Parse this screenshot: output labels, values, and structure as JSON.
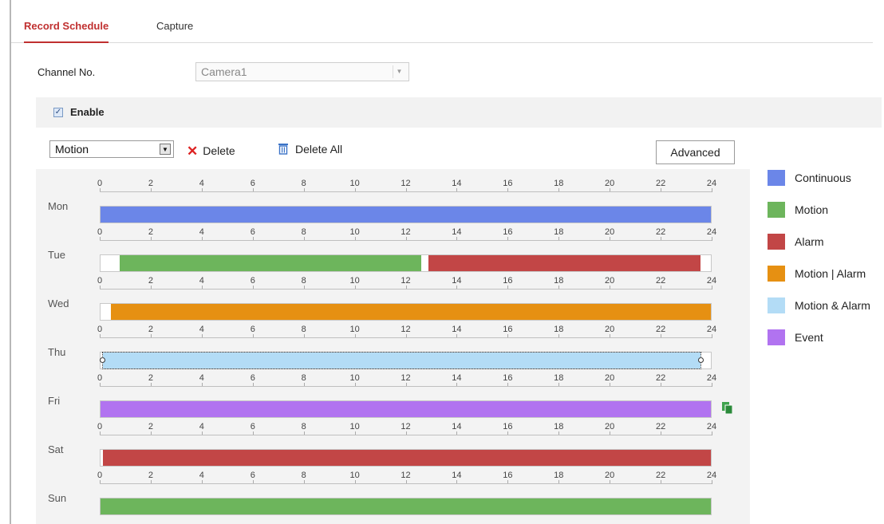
{
  "tabs": [
    {
      "label": "Record Schedule",
      "active": true
    },
    {
      "label": "Capture",
      "active": false
    }
  ],
  "channel": {
    "label": "Channel No.",
    "value": "Camera1"
  },
  "enable": {
    "label": "Enable",
    "checked": true
  },
  "toolbar": {
    "record_type": "Motion",
    "delete_label": "Delete",
    "delete_all_label": "Delete All",
    "advanced_label": "Advanced"
  },
  "hour_ticks": [
    "0",
    "2",
    "4",
    "6",
    "8",
    "10",
    "12",
    "14",
    "16",
    "18",
    "20",
    "22",
    "24"
  ],
  "legend": [
    {
      "label": "Continuous",
      "color": "#6b86e8"
    },
    {
      "label": "Motion",
      "color": "#6db55c"
    },
    {
      "label": "Alarm",
      "color": "#c24646"
    },
    {
      "label": "Motion | Alarm",
      "color": "#e69012"
    },
    {
      "label": "Motion & Alarm",
      "color": "#b3dcf6"
    },
    {
      "label": "Event",
      "color": "#b173f0"
    }
  ],
  "days": [
    {
      "label": "Mon",
      "segments": [
        {
          "start": 0,
          "end": 24,
          "type": "Continuous"
        }
      ]
    },
    {
      "label": "Tue",
      "segments": [
        {
          "start": 0.75,
          "end": 12.6,
          "type": "Motion"
        },
        {
          "start": 12.9,
          "end": 23.6,
          "type": "Alarm"
        }
      ]
    },
    {
      "label": "Wed",
      "segments": [
        {
          "start": 0.4,
          "end": 24,
          "type": "Motion | Alarm"
        }
      ]
    },
    {
      "label": "Thu",
      "segments": [
        {
          "start": 0.1,
          "end": 23.6,
          "type": "Motion & Alarm",
          "selected": true
        }
      ]
    },
    {
      "label": "Fri",
      "segments": [
        {
          "start": 0,
          "end": 24,
          "type": "Event"
        }
      ],
      "copy_icon": "copy-icon"
    },
    {
      "label": "Sat",
      "segments": [
        {
          "start": 0.1,
          "end": 24,
          "type": "Alarm"
        }
      ]
    },
    {
      "label": "Sun",
      "segments": [
        {
          "start": 0,
          "end": 24,
          "type": "Motion"
        }
      ]
    }
  ]
}
